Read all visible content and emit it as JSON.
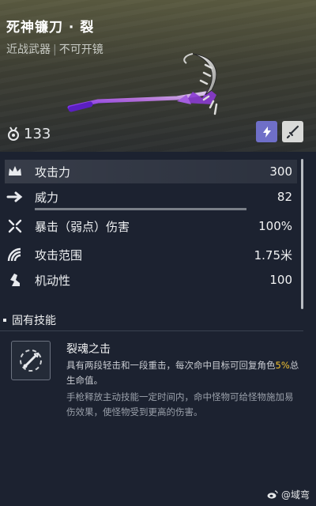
{
  "weapon": {
    "title": "死神镰刀 · 裂",
    "category": "近战武器",
    "separator": "|",
    "scope_note": "不可开镜",
    "level": "133"
  },
  "badges": [
    {
      "name": "bolt-icon",
      "color": "#6f6fc8"
    },
    {
      "name": "sword-icon",
      "color": "#d9dad8"
    }
  ],
  "stats": [
    {
      "label": "攻击力",
      "value": "300",
      "icon": "crown-icon"
    },
    {
      "label": "威力",
      "value": "82",
      "icon": "arrow-icon",
      "bar_fraction": 0.82
    },
    {
      "label": "暴击（弱点）伤害",
      "value": "100%",
      "icon": "crosshair-icon"
    },
    {
      "label": "攻击范围",
      "value": "1.75米",
      "icon": "range-icon"
    },
    {
      "label": "机动性",
      "value": "100",
      "icon": "boot-icon"
    }
  ],
  "section": {
    "title": "固有技能"
  },
  "skill": {
    "name": "裂魂之击",
    "desc_part1": "具有两段轻击和一段重击，每次命中目标可回复角色",
    "desc_highlight": "5%",
    "desc_part2": "总生命值。",
    "desc_extra": "手枪释放主动技能一定时间内，命中怪物可给怪物施加易伤效果，使怪物受到更高的伤害。"
  },
  "watermark": {
    "text": "@域弯"
  },
  "colors": {
    "highlight": "#f2c231",
    "background": "#1c2230"
  }
}
